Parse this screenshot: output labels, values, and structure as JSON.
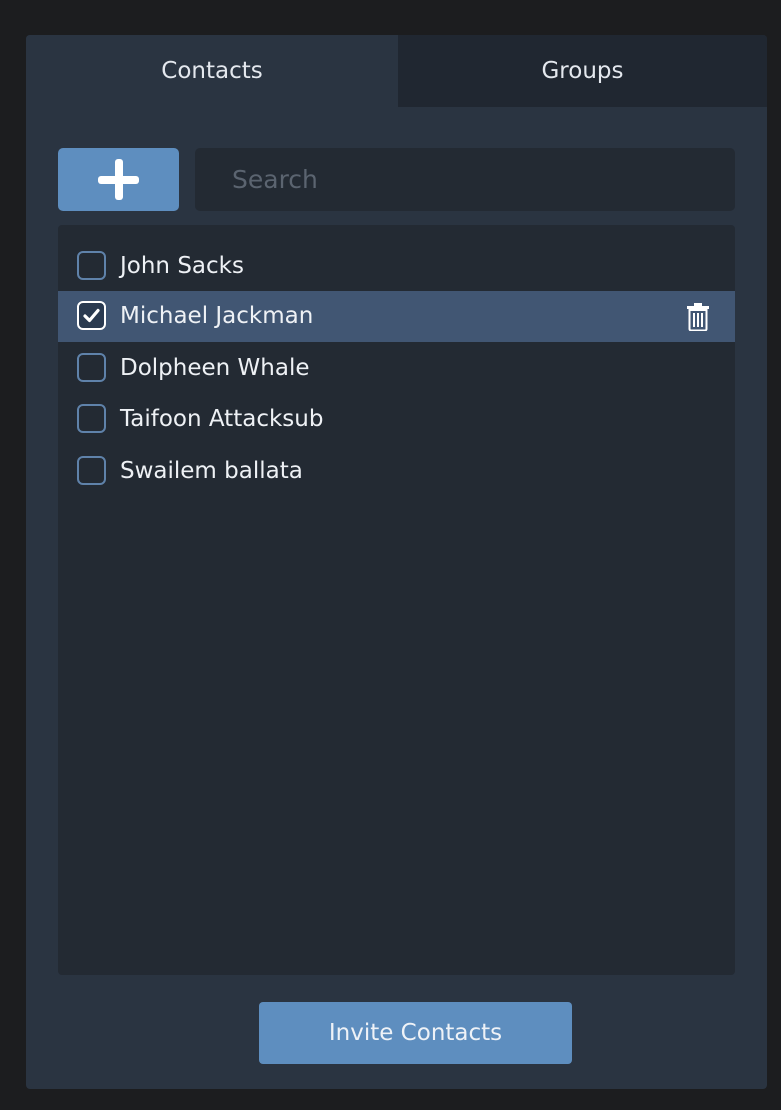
{
  "tabs": [
    {
      "label": "Contacts",
      "active": true
    },
    {
      "label": "Groups",
      "active": false
    }
  ],
  "add_button": {
    "icon": "plus-icon"
  },
  "search": {
    "placeholder": "Search",
    "value": ""
  },
  "contacts": [
    {
      "name": "John Sacks",
      "checked": false
    },
    {
      "name": "Michael Jackman",
      "checked": true,
      "selected": true,
      "row_action_icon": "trash-icon"
    },
    {
      "name": "Dolpheen Whale",
      "checked": false
    },
    {
      "name": "Taifoon Attacksub",
      "checked": false
    },
    {
      "name": "Swailem ballata",
      "checked": false
    }
  ],
  "invite_button": {
    "label": "Invite Contacts"
  },
  "colors": {
    "accent": "#5e8ebf",
    "panel": "#2a3441",
    "list_bg": "#232a33",
    "selected_row": "#415673",
    "checkbox_border": "#5f82aa"
  }
}
